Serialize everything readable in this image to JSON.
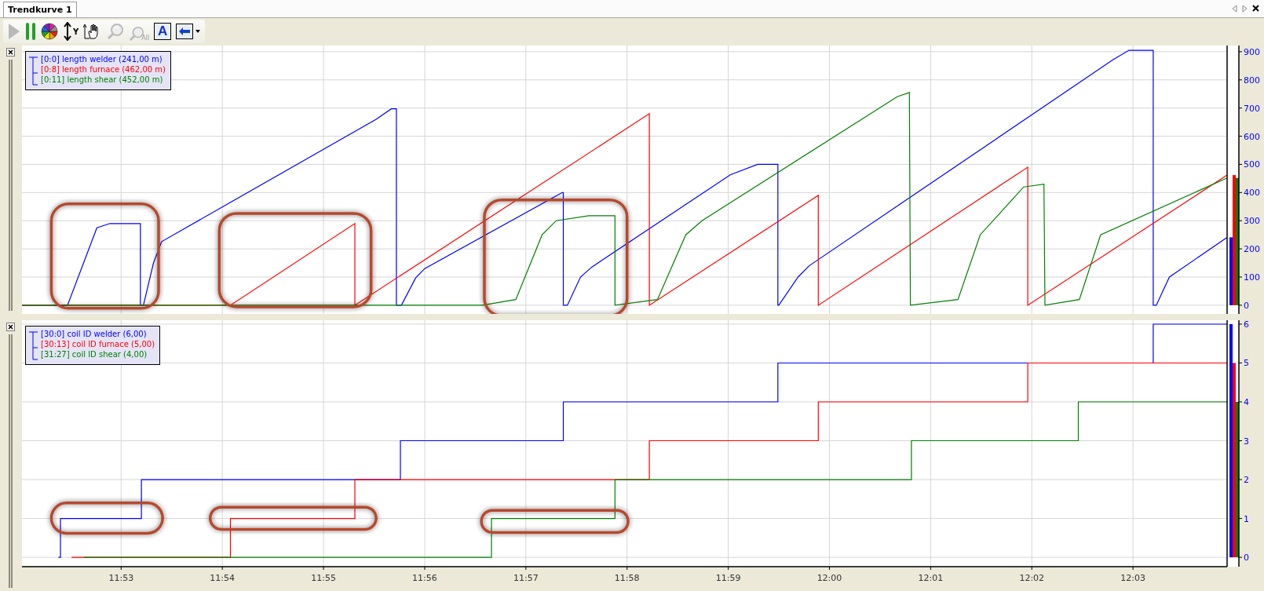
{
  "tabs": [
    {
      "label": "Trendkurve 1",
      "selected": true
    }
  ],
  "toolbar": [
    {
      "kind": "play",
      "disabled": true
    },
    {
      "kind": "pause",
      "disabled": false
    },
    {
      "kind": "colors",
      "disabled": false
    },
    {
      "kind": "y-scale",
      "label": "Y",
      "disabled": false
    },
    {
      "kind": "pan",
      "disabled": false
    },
    {
      "kind": "zoom",
      "disabled": true
    },
    {
      "kind": "zoom-all",
      "label": "All",
      "disabled": true
    },
    {
      "kind": "font",
      "label": "A",
      "disabled": false
    },
    {
      "kind": "arrow",
      "disabled": false
    }
  ],
  "panes": [
    {
      "readings": [
        "(241,00 m)",
        "(462,00 m)",
        "(452,00 m)"
      ],
      "chart_data": {
        "type": "line",
        "grid": true,
        "xlim": [
          712.02,
          723.93
        ],
        "ylim": [
          -31,
          922
        ],
        "yticks": [
          0,
          100,
          200,
          300,
          400,
          500,
          600,
          700,
          800,
          900
        ],
        "series": [
          {
            "name": "[0:0] length welder",
            "color": "#0000ff",
            "x": [
              712.02,
              712.47,
              712.76,
              712.89,
              713.19,
              713.19,
              713.22,
              713.32,
              713.4,
              715.52,
              715.67,
              715.72,
              715.72,
              715.77,
              715.91,
              716.0,
              717.36,
              717.37,
              717.37,
              717.41,
              717.54,
              717.65,
              719.02,
              719.29,
              719.49,
              719.49,
              719.5,
              719.69,
              719.8,
              722.8,
              722.96,
              723.2,
              723.2,
              723.23,
              723.36,
              723.93
            ],
            "values": [
              0,
              0,
              275,
              290,
              290,
              0,
              0,
              150,
              226,
              660,
              697,
              697,
              0,
              0,
              97,
              130,
              400,
              400,
              0,
              0,
              100,
              135,
              463,
              500,
              500,
              0,
              0,
              100,
              140,
              871,
              905,
              905,
              0,
              0,
              100,
              241
            ]
          },
          {
            "name": "[0:8] length furnace",
            "color": "#ff0000",
            "x": [
              712.02,
              714.08,
              715.31,
              715.31,
              718.22,
              718.22,
              719.89,
              719.89,
              721.96,
              721.96,
              723.93
            ],
            "values": [
              0,
              0,
              290,
              0,
              680,
              0,
              390,
              0,
              490,
              0,
              462
            ]
          },
          {
            "name": "[0:11] length shear",
            "color": "#008000",
            "x": [
              712.02,
              716.57,
              716.9,
              717.16,
              717.3,
              717.62,
              717.88,
              717.88,
              718.3,
              718.58,
              718.74,
              720.67,
              720.79,
              720.8,
              721.27,
              721.49,
              721.92,
              722.12,
              722.13,
              722.47,
              722.68,
              723.93
            ],
            "values": [
              0,
              0,
              20,
              250,
              300,
              318,
              318,
              0,
              20,
              250,
              300,
              740,
              755,
              0,
              20,
              250,
              420,
              430,
              0,
              20,
              250,
              452
            ]
          }
        ]
      }
    },
    {
      "readings": [
        "(6,00)",
        "(5,00)",
        "(4,00)"
      ],
      "chart_data": {
        "type": "line",
        "grid": true,
        "xlim": [
          712.02,
          723.93
        ],
        "ylim": [
          -0.24,
          6.1
        ],
        "xticks": [
          {
            "value": 713,
            "label": "11:53"
          },
          {
            "value": 714,
            "label": "11:54"
          },
          {
            "value": 715,
            "label": "11:55"
          },
          {
            "value": 716,
            "label": "11:56"
          },
          {
            "value": 717,
            "label": "11:57"
          },
          {
            "value": 718,
            "label": "11:58"
          },
          {
            "value": 719,
            "label": "11:59"
          },
          {
            "value": 720,
            "label": "12:00"
          },
          {
            "value": 721,
            "label": "12:01"
          },
          {
            "value": 722,
            "label": "12:02"
          },
          {
            "value": 723,
            "label": "12:03"
          }
        ],
        "yticks": [
          0,
          1,
          2,
          3,
          4,
          5,
          6
        ],
        "series": [
          {
            "name": "[30:0] coil ID welder",
            "color": "#0000ff",
            "x": [
              712.38,
              712.4,
              712.4,
              713.2,
              713.2,
              715.76,
              715.76,
              717.37,
              717.37,
              719.49,
              719.49,
              723.2,
              723.2,
              723.93
            ],
            "values": [
              0,
              0,
              1,
              1,
              2,
              2,
              3,
              3,
              4,
              4,
              5,
              5,
              6,
              6
            ]
          },
          {
            "name": "[30:13] coil ID furnace",
            "color": "#ff0000",
            "x": [
              712.51,
              714.08,
              714.08,
              715.31,
              715.31,
              718.22,
              718.22,
              719.89,
              719.89,
              721.96,
              721.96,
              723.93
            ],
            "values": [
              0,
              0,
              1,
              1,
              2,
              2,
              3,
              3,
              4,
              4,
              5,
              5
            ]
          },
          {
            "name": "[31:27] coil ID shear",
            "color": "#008000",
            "x": [
              712.63,
              716.66,
              716.66,
              717.88,
              717.88,
              720.81,
              720.81,
              722.46,
              722.46,
              723.93
            ],
            "values": [
              0,
              0,
              1,
              1,
              2,
              2,
              3,
              3,
              4,
              4
            ]
          }
        ]
      }
    }
  ]
}
